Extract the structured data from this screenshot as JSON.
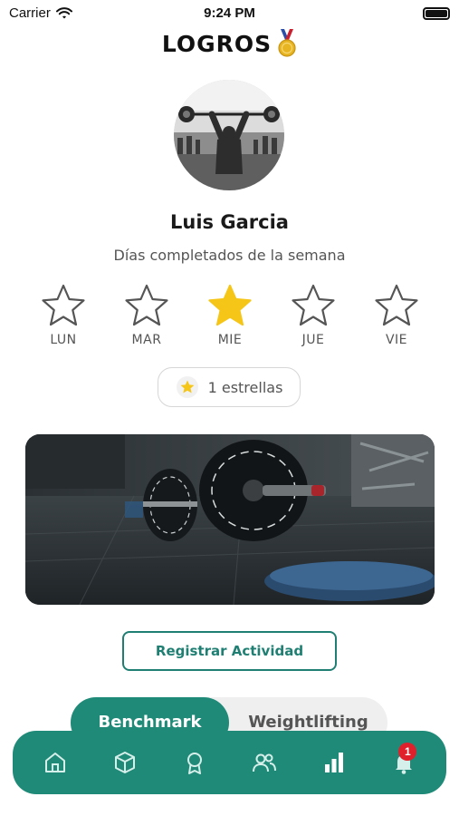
{
  "status": {
    "carrier": "Carrier",
    "time": "9:24 PM"
  },
  "header": {
    "title": "LOGROS",
    "icon": "medal-icon"
  },
  "profile": {
    "name": "Luis Garcia"
  },
  "week": {
    "label": "Días completados de la semana",
    "days": [
      {
        "label": "LUN",
        "completed": false
      },
      {
        "label": "MAR",
        "completed": false
      },
      {
        "label": "MIE",
        "completed": true
      },
      {
        "label": "JUE",
        "completed": false
      },
      {
        "label": "VIE",
        "completed": false
      }
    ]
  },
  "stars_summary": {
    "text": "1 estrellas",
    "icon": "star-icon"
  },
  "actions": {
    "register_label": "Registrar Actividad"
  },
  "segments": {
    "active": "Benchmark",
    "inactive": "Weightlifting"
  },
  "tabbar": {
    "items": [
      "home-icon",
      "box-icon",
      "award-icon",
      "users-icon",
      "chart-icon",
      "bell-icon"
    ],
    "notification_count": "1"
  },
  "colors": {
    "accent": "#1f8a78",
    "star_active": "#f5c518",
    "badge": "#e0202a"
  }
}
